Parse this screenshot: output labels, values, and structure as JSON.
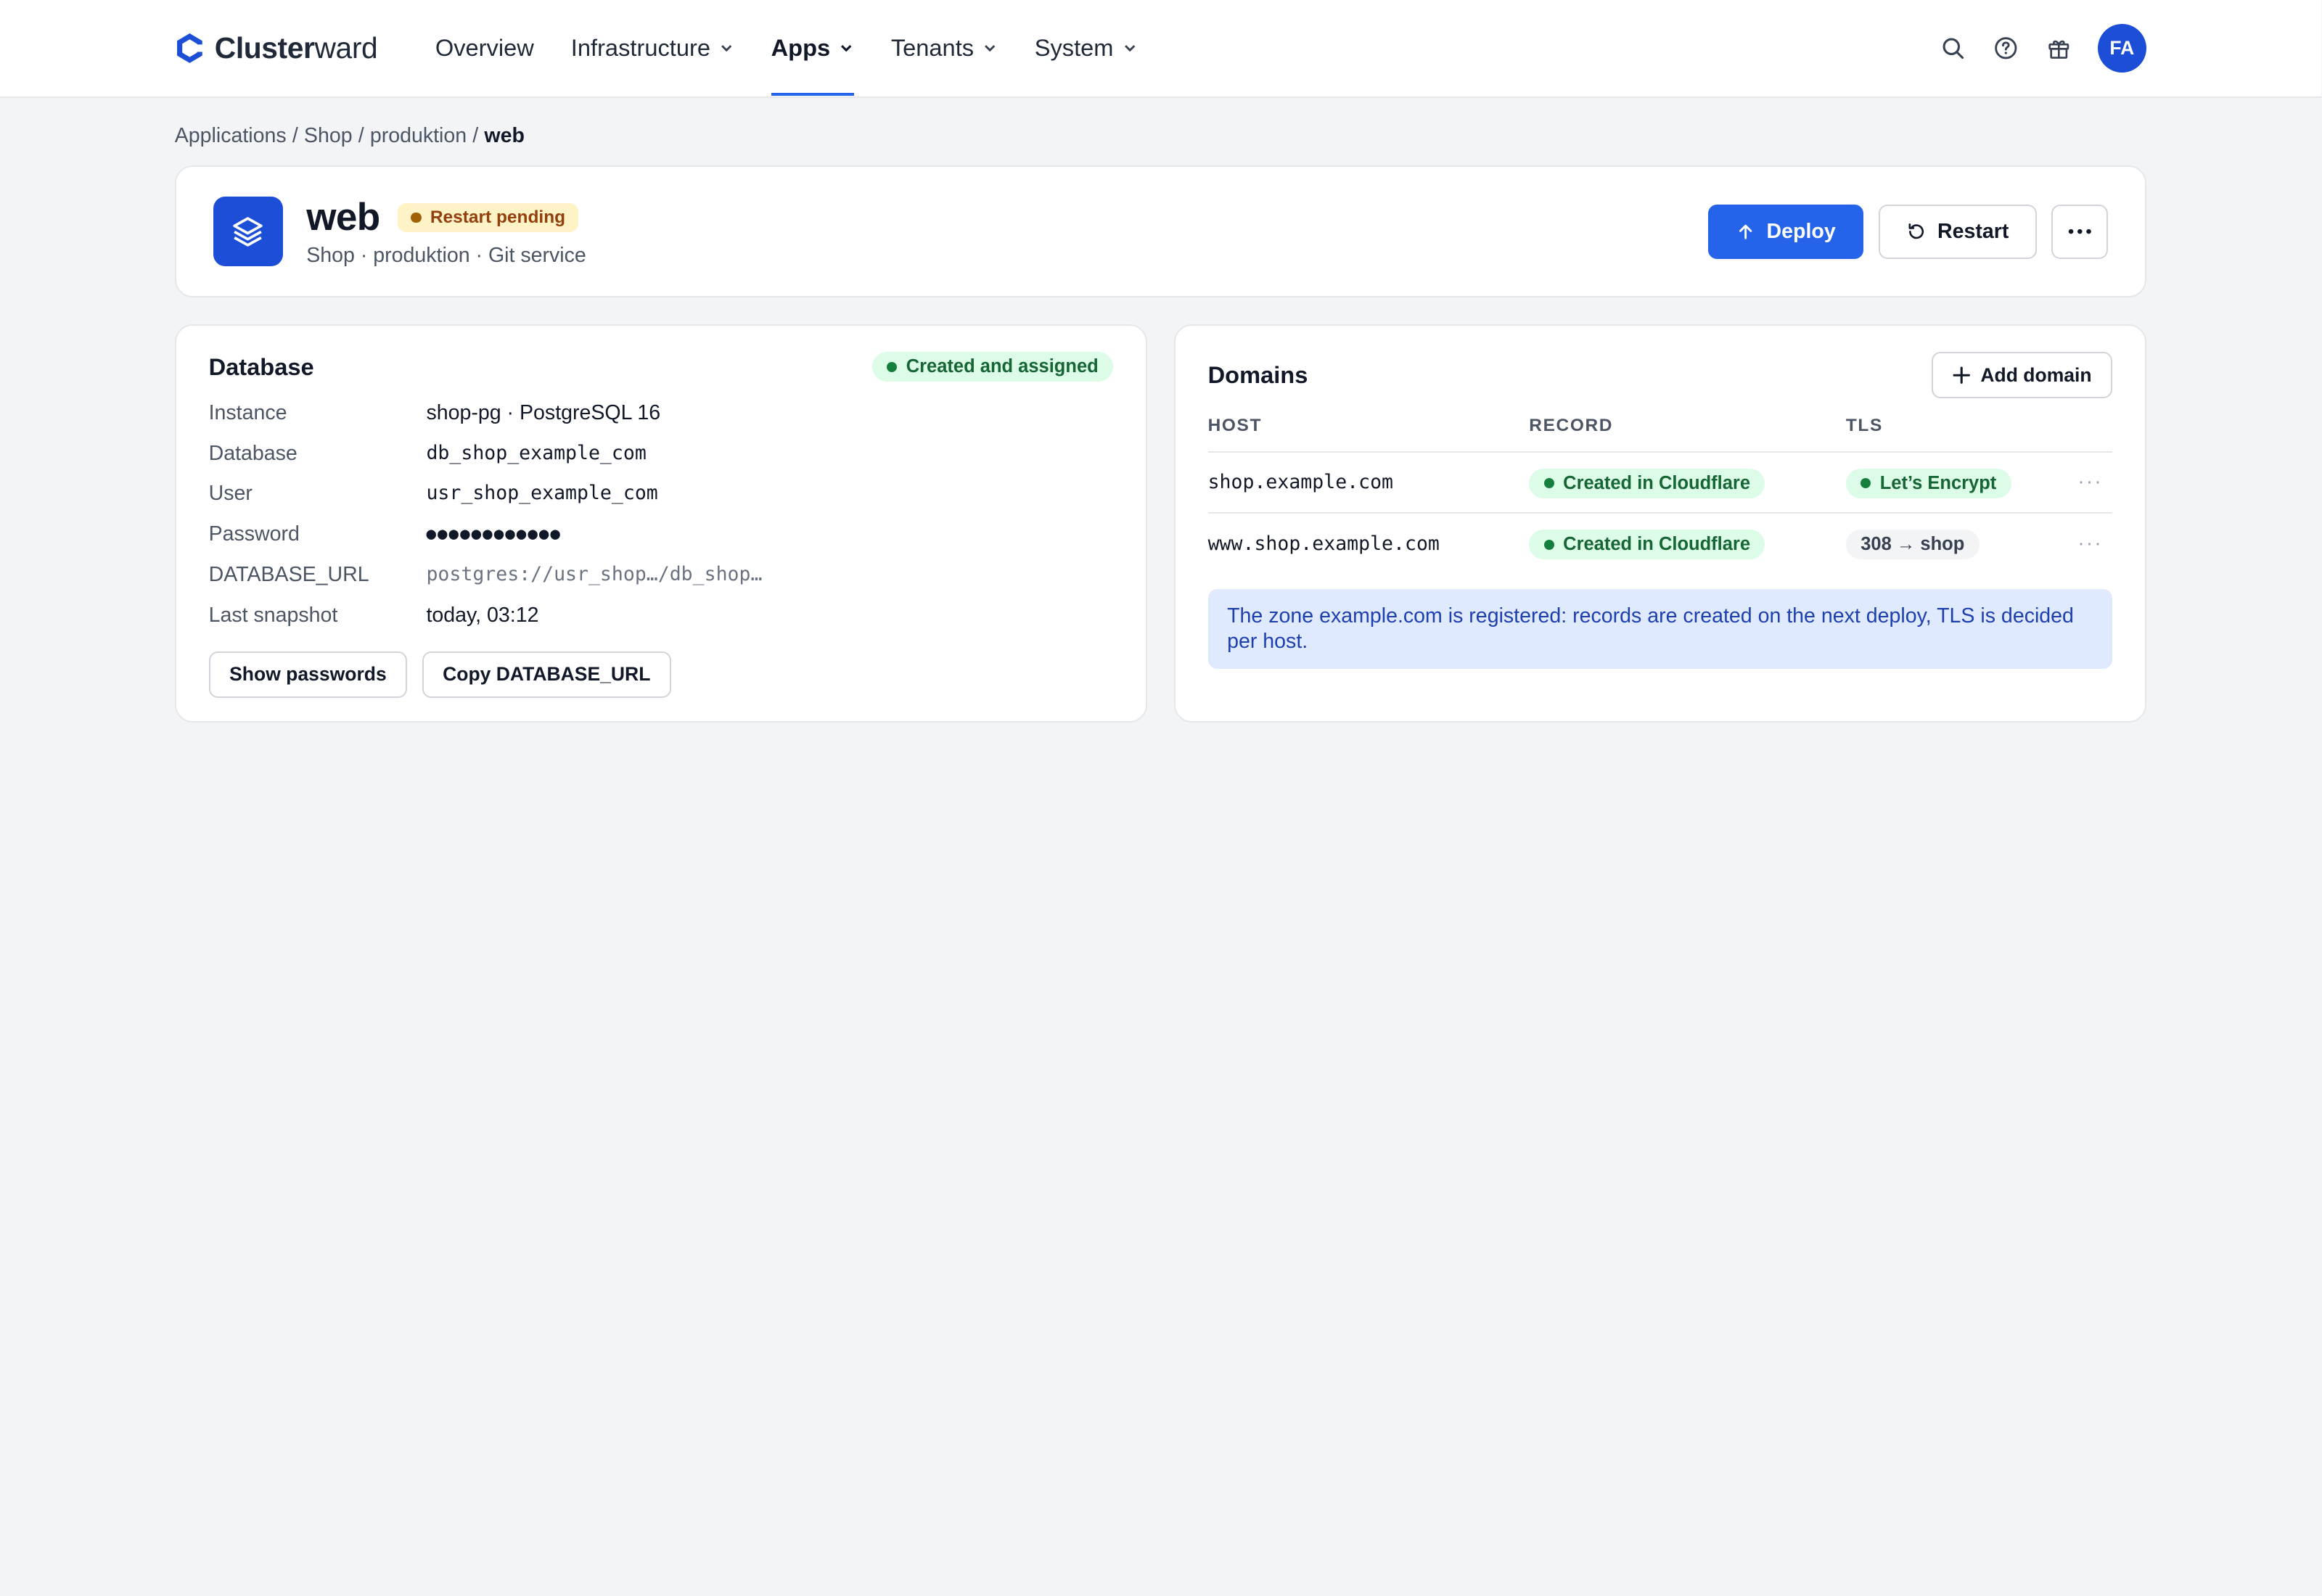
{
  "brand": {
    "name_bold": "Cluster",
    "name_rest": "ward"
  },
  "nav": {
    "items": [
      {
        "label": "Overview",
        "has_menu": false,
        "active": false
      },
      {
        "label": "Infrastructure",
        "has_menu": true,
        "active": false
      },
      {
        "label": "Apps",
        "has_menu": true,
        "active": true
      },
      {
        "label": "Tenants",
        "has_menu": true,
        "active": false
      },
      {
        "label": "System",
        "has_menu": true,
        "active": false
      }
    ],
    "avatar_initials": "FA"
  },
  "breadcrumb": {
    "items": [
      "Applications",
      "Shop",
      "produktion"
    ],
    "current": "web",
    "separator": "/"
  },
  "app": {
    "title": "web",
    "status_badge": "Restart pending",
    "subtitle": "Shop · produktion · Git service",
    "actions": {
      "deploy": "Deploy",
      "restart": "Restart"
    }
  },
  "database": {
    "title": "Database",
    "status": "Created and assigned",
    "rows": [
      {
        "key": "Instance",
        "value": "shop-pg · PostgreSQL 16"
      },
      {
        "key": "Database",
        "value": "db_shop_example_com"
      },
      {
        "key": "User",
        "value": "usr_shop_example_com"
      },
      {
        "key": "Password",
        "value": "●●●●●●●●●●●●"
      },
      {
        "key": "DATABASE_URL",
        "value": "postgres://usr_shop…/db_shop…"
      },
      {
        "key": "Last snapshot",
        "value": "today, 03:12"
      }
    ],
    "show_passwords": "Show passwords",
    "copy_url": "Copy DATABASE_URL"
  },
  "domains": {
    "title": "Domains",
    "add_label": "Add domain",
    "columns": [
      "HOST",
      "RECORD",
      "TLS"
    ],
    "rows": [
      {
        "host": "shop.example.com",
        "record": "Created in Cloudflare",
        "tls": "Let’s Encrypt",
        "tls_style": "green"
      },
      {
        "host": "www.shop.example.com",
        "record": "Created in Cloudflare",
        "tls": "308 → shop",
        "tls_style": "gray"
      }
    ],
    "row_menu": "···",
    "info": "The zone example.com is registered: records are created on the next deploy, TLS is decided per host."
  },
  "colors": {
    "accent": "#2563eb",
    "pending_bg": "#fef3c7",
    "pending_dot": "#a16207",
    "success_bg": "#dcfce7",
    "success_dot": "#15803d"
  }
}
